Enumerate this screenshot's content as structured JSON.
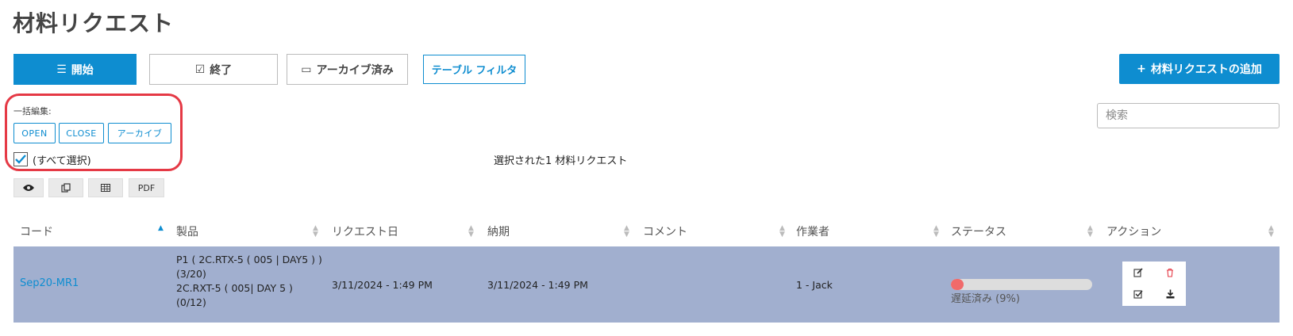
{
  "page_title": "材料リクエスト",
  "tabs": {
    "open": "開始",
    "closed": "終了",
    "archived": "アーカイブ済み",
    "table_filter": "テーブル フィルタ"
  },
  "add_button": "材料リクエストの追加",
  "search": {
    "placeholder": "検索"
  },
  "bulk_edit": {
    "label": "一括編集:",
    "open": "OPEN",
    "close": "CLOSE",
    "archive": "アーカイブ"
  },
  "select_all": "(すべて選択)",
  "selection_info": "選択された1 材料リクエスト",
  "tools": {
    "pdf": "PDF"
  },
  "table": {
    "columns": [
      "コード",
      "製品",
      "リクエスト日",
      "納期",
      "コメント",
      "作業者",
      "ステータス",
      "アクション"
    ],
    "rows": [
      {
        "code": "Sep20-MR1",
        "product_lines": [
          "P1 ( 2C.RTX-5 ( 005 | DAY5 ) )",
          "(3/20)",
          "2C.RXT-5 ( 005| DAY 5 )",
          "(0/12)"
        ],
        "request_date": "3/11/2024 - 1:49 PM",
        "due_date": "3/11/2024 - 1:49 PM",
        "comment": "",
        "worker": "1 - Jack",
        "status_progress": 0.09,
        "status_text": "遅延済み (9%)"
      }
    ]
  },
  "colors": {
    "accent": "#0e8dd0",
    "row_selected": "#a1afcf",
    "highlight_box": "#e53945",
    "progress_fill": "#f06a6a"
  },
  "icons": [
    "list-icon",
    "check-square-icon",
    "inbox-icon",
    "plus-icon",
    "eye-icon",
    "copy-icon",
    "table-icon",
    "edit-icon",
    "trash-icon",
    "download-icon",
    "sort-icon"
  ]
}
